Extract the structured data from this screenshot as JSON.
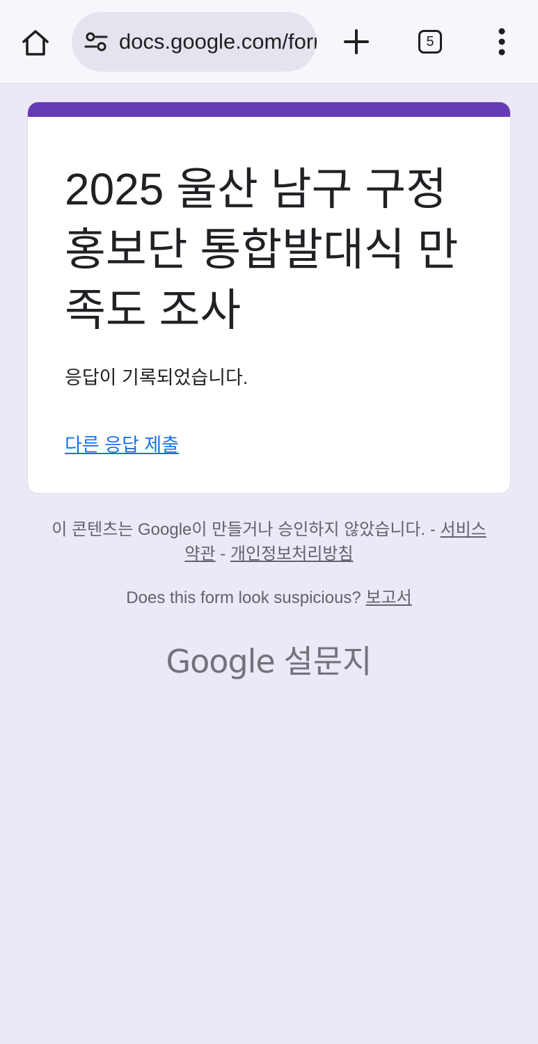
{
  "browser": {
    "url": "docs.google.com/forms",
    "tab_count": "5",
    "home_icon": "home-icon",
    "site_info_icon": "tune-icon",
    "new_tab_icon": "plus-icon",
    "menu_icon": "more-vert-icon"
  },
  "form": {
    "accent_color": "#673ab7",
    "title": "2025 울산 남구 구정 홍보단 통합발대식 만족도 조사",
    "confirmation": "응답이 기록되었습니다.",
    "submit_another": "다른 응답 제출"
  },
  "footer": {
    "disclaimer": "이 콘텐츠는 Google이 만들거나 승인하지 않았습니다. -",
    "terms_link": "서비스 약관",
    "separator": "-",
    "privacy_link": "개인정보처리방침",
    "report_prefix": "Does this form look suspicious?",
    "report_link": "보고서",
    "brand_google": "Google",
    "brand_forms": "설문지"
  }
}
